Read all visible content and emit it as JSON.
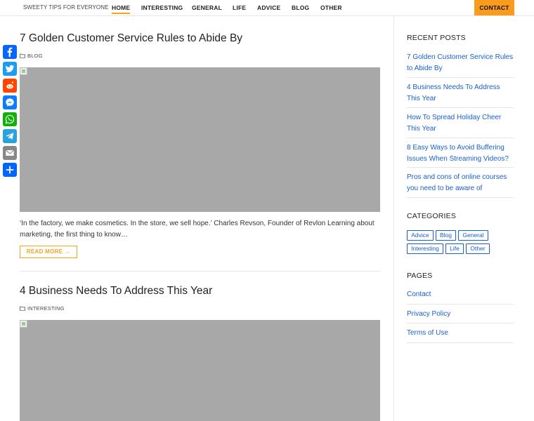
{
  "header": {
    "site_title": "SWEETY TIPS FOR EVERYONE",
    "nav": [
      "HOME",
      "INTERESTING",
      "GENERAL",
      "LIFE",
      "ADVICE",
      "BLOG",
      "OTHER"
    ],
    "contact_label": "CONTACT",
    "accent": "#f99b1c"
  },
  "share": [
    "facebook-icon",
    "twitter-icon",
    "reddit-icon",
    "messenger-icon",
    "whatsapp-icon",
    "telegram-icon",
    "email-icon",
    "share-icon"
  ],
  "posts": [
    {
      "title": "7 Golden Customer Service Rules to Abide By",
      "category": "BLOG",
      "excerpt": "‘In the factory, we make cosmetics. In the store, we sell hope.’ Charles Revson, Founder of Revlon Learning about marketing, the first thing to know…",
      "read_more": "READ MORE →"
    },
    {
      "title": "4 Business Needs To Address This Year",
      "category": "INTERESTING"
    }
  ],
  "sidebar": {
    "recent_title": "RECENT POSTS",
    "recent": [
      "7 Golden Customer Service Rules to Abide By",
      "4 Business Needs To Address This Year",
      "How To Spread Holiday Cheer This Year",
      "8 Easy Ways to Avoid Buffering Issues When Streaming Videos?",
      "Pros and cons of online courses you need to be aware of"
    ],
    "categories_title": "CATEGORIES",
    "categories": [
      "Advice",
      "Blog",
      "General",
      "Interesting",
      "Life",
      "Other"
    ],
    "pages_title": "PAGES",
    "pages": [
      "Contact",
      "Privacy Policy",
      "Terms of Use"
    ],
    "link_color": "#1a5fd0"
  }
}
